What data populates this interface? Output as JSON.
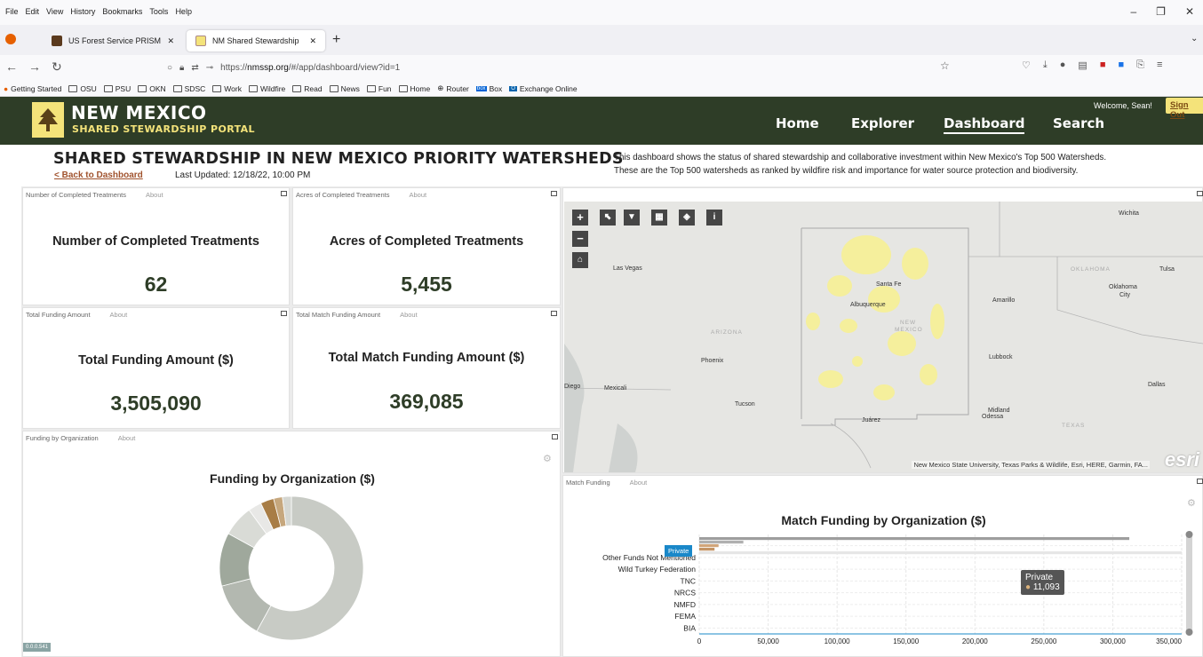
{
  "browser": {
    "menu": [
      "File",
      "Edit",
      "View",
      "History",
      "Bookmarks",
      "Tools",
      "Help"
    ],
    "tabs": [
      {
        "label": "US Forest Service PRISM",
        "active": false
      },
      {
        "label": "NM Shared Stewardship",
        "active": true
      }
    ],
    "url_prefix": "https://",
    "url_domain": "nmssp.org",
    "url_path": "/#/app/dashboard/view?id=1",
    "bookmarks": [
      "Getting Started",
      "OSU",
      "PSU",
      "OKN",
      "SDSC",
      "Work",
      "Wildfire",
      "Read",
      "News",
      "Fun",
      "Home",
      "Router",
      "Box",
      "Exchange Online"
    ]
  },
  "header": {
    "title": "NEW MEXICO",
    "subtitle": "SHARED STEWARDSHIP PORTAL",
    "nav": [
      "Home",
      "Explorer",
      "Dashboard",
      "Search"
    ],
    "active_nav": "Dashboard",
    "welcome": "Welcome, Sean!",
    "signout": "Sign Out",
    "bg_color": "#2e3d27",
    "accent_color": "#f4e37a"
  },
  "page": {
    "heading": "SHARED STEWARDSHIP IN NEW MEXICO PRIORITY WATERSHEDS",
    "back_link": "< Back to Dashboard",
    "last_updated": "Last Updated: 12/18/22, 10:00 PM",
    "description_line1": "This dashboard shows the status of shared stewardship and collaborative investment within New Mexico's Top 500 Watersheds.",
    "description_line2": "These are the Top 500 watersheds as ranked by wildfire risk and importance for water source protection and biodiversity."
  },
  "panels": {
    "about": "About",
    "completed_treatments": {
      "title": "Number of Completed Treatments",
      "label": "Number of Completed Treatments",
      "value": "62"
    },
    "acres": {
      "title": "Acres of Completed Treatments",
      "label": "Acres of Completed Treatments",
      "value": "5,455"
    },
    "funding": {
      "title": "Total Funding Amount",
      "label": "Total Funding Amount ($)",
      "value": "3,505,090"
    },
    "match_funding": {
      "title": "Total Match Funding Amount",
      "label": "Total Match Funding Amount ($)",
      "value": "369,085"
    },
    "funding_org": {
      "title": "Funding by Organization",
      "chart_title": "Funding by Organization ($)"
    },
    "match_chart": {
      "title": "Match Funding",
      "chart_title": "Match Funding by Organization ($)"
    },
    "version": "0.0.0.541"
  },
  "map": {
    "labels": [
      {
        "text": "Wichita"
      },
      {
        "text": "Las Vegas"
      },
      {
        "text": "OKLAHOMA"
      },
      {
        "text": "Tulsa"
      },
      {
        "text": "Oklahoma"
      },
      {
        "text": "City"
      },
      {
        "text": "Santa Fe"
      },
      {
        "text": "Albuquerque"
      },
      {
        "text": "Amarillo"
      },
      {
        "text": "NEW"
      },
      {
        "text": "MEXICO"
      },
      {
        "text": "ARIZONA"
      },
      {
        "text": "Phoenix"
      },
      {
        "text": "Lubbock"
      },
      {
        "text": "Diego"
      },
      {
        "text": "Mexicali"
      },
      {
        "text": "Dallas"
      },
      {
        "text": "Tucson"
      },
      {
        "text": "Midland"
      },
      {
        "text": "Odessa"
      },
      {
        "text": "Juárez"
      },
      {
        "text": "TEXAS"
      }
    ],
    "attribution": "New Mexico State University, Texas Parks & Wildlife, Esri, HERE, Garmin, FA...",
    "esri": "esri"
  },
  "chart_data": [
    {
      "type": "pie",
      "title": "Funding by Organization ($)",
      "donut": true,
      "slices": [
        {
          "value": 0.58,
          "color": "#c8cbc5"
        },
        {
          "value": 0.13,
          "color": "#b3b8b0"
        },
        {
          "value": 0.12,
          "color": "#9fa89c"
        },
        {
          "value": 0.07,
          "color": "#d9dbd6"
        },
        {
          "value": 0.03,
          "color": "#e8e8e6"
        },
        {
          "value": 0.03,
          "color": "#a87d46"
        },
        {
          "value": 0.02,
          "color": "#c6a77d"
        },
        {
          "value": 0.02,
          "color": "#d5d7d2"
        }
      ]
    },
    {
      "type": "bar",
      "orientation": "horizontal",
      "title": "Match Funding by Organization ($)",
      "categories": [
        "Private",
        "Other Funds Not Mentioned",
        "Wild Turkey Federation",
        "TNC",
        "NRCS",
        "NMFD",
        "FEMA",
        "BIA"
      ],
      "xlim": [
        0,
        350000
      ],
      "xticks": [
        "0",
        "50,000",
        "100,000",
        "150,000",
        "200,000",
        "250,000",
        "300,000",
        "350,000"
      ],
      "series_bars": [
        {
          "value": 312000,
          "color": "#9e9e9e"
        },
        {
          "value": 32000,
          "color": "#b0b0b0"
        },
        {
          "value": 14000,
          "color": "#d1a57a"
        },
        {
          "value": 11093,
          "color": "#c49466"
        },
        {
          "value": 350000,
          "color": "#e6e6e6"
        }
      ],
      "tooltip": {
        "label": "Private",
        "value": "11,093"
      },
      "highlight_flag": "Private"
    }
  ]
}
